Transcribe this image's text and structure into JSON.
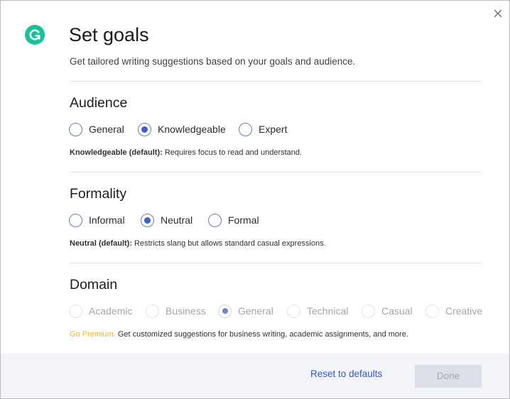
{
  "dialog": {
    "title": "Set goals",
    "subtitle": "Get tailored writing suggestions based on your goals and audience.",
    "close_icon": "close-icon",
    "logo_icon": "grammarly-logo-icon",
    "brand_color": "#15c39a"
  },
  "audience": {
    "title": "Audience",
    "options": [
      {
        "label": "General",
        "selected": false
      },
      {
        "label": "Knowledgeable",
        "selected": true
      },
      {
        "label": "Expert",
        "selected": false
      }
    ],
    "desc_bold": "Knowledgeable (default):",
    "desc_text": " Requires focus to read and understand."
  },
  "formality": {
    "title": "Formality",
    "options": [
      {
        "label": "Informal",
        "selected": false
      },
      {
        "label": "Neutral",
        "selected": true
      },
      {
        "label": "Formal",
        "selected": false
      }
    ],
    "desc_bold": "Neutral (default):",
    "desc_text": " Restricts slang but allows standard casual expressions."
  },
  "domain": {
    "title": "Domain",
    "options": [
      {
        "label": "Academic",
        "selected": false,
        "disabled": true
      },
      {
        "label": "Business",
        "selected": false,
        "disabled": true
      },
      {
        "label": "General",
        "selected": true,
        "disabled": true
      },
      {
        "label": "Technical",
        "selected": false,
        "disabled": true
      },
      {
        "label": "Casual",
        "selected": false,
        "disabled": true
      },
      {
        "label": "Creative",
        "selected": false,
        "disabled": true
      }
    ],
    "premium_link": "Go Premium.",
    "premium_text": " Get customized suggestions for business writing, academic assignments, and more.",
    "premium_color": "#f2b51e"
  },
  "footer": {
    "reset_label": "Reset to defaults",
    "done_label": "Done",
    "done_enabled": false
  },
  "colors": {
    "accent": "#3e5fcf",
    "link": "#3459c2",
    "footer_bg": "#f3f4f8"
  }
}
